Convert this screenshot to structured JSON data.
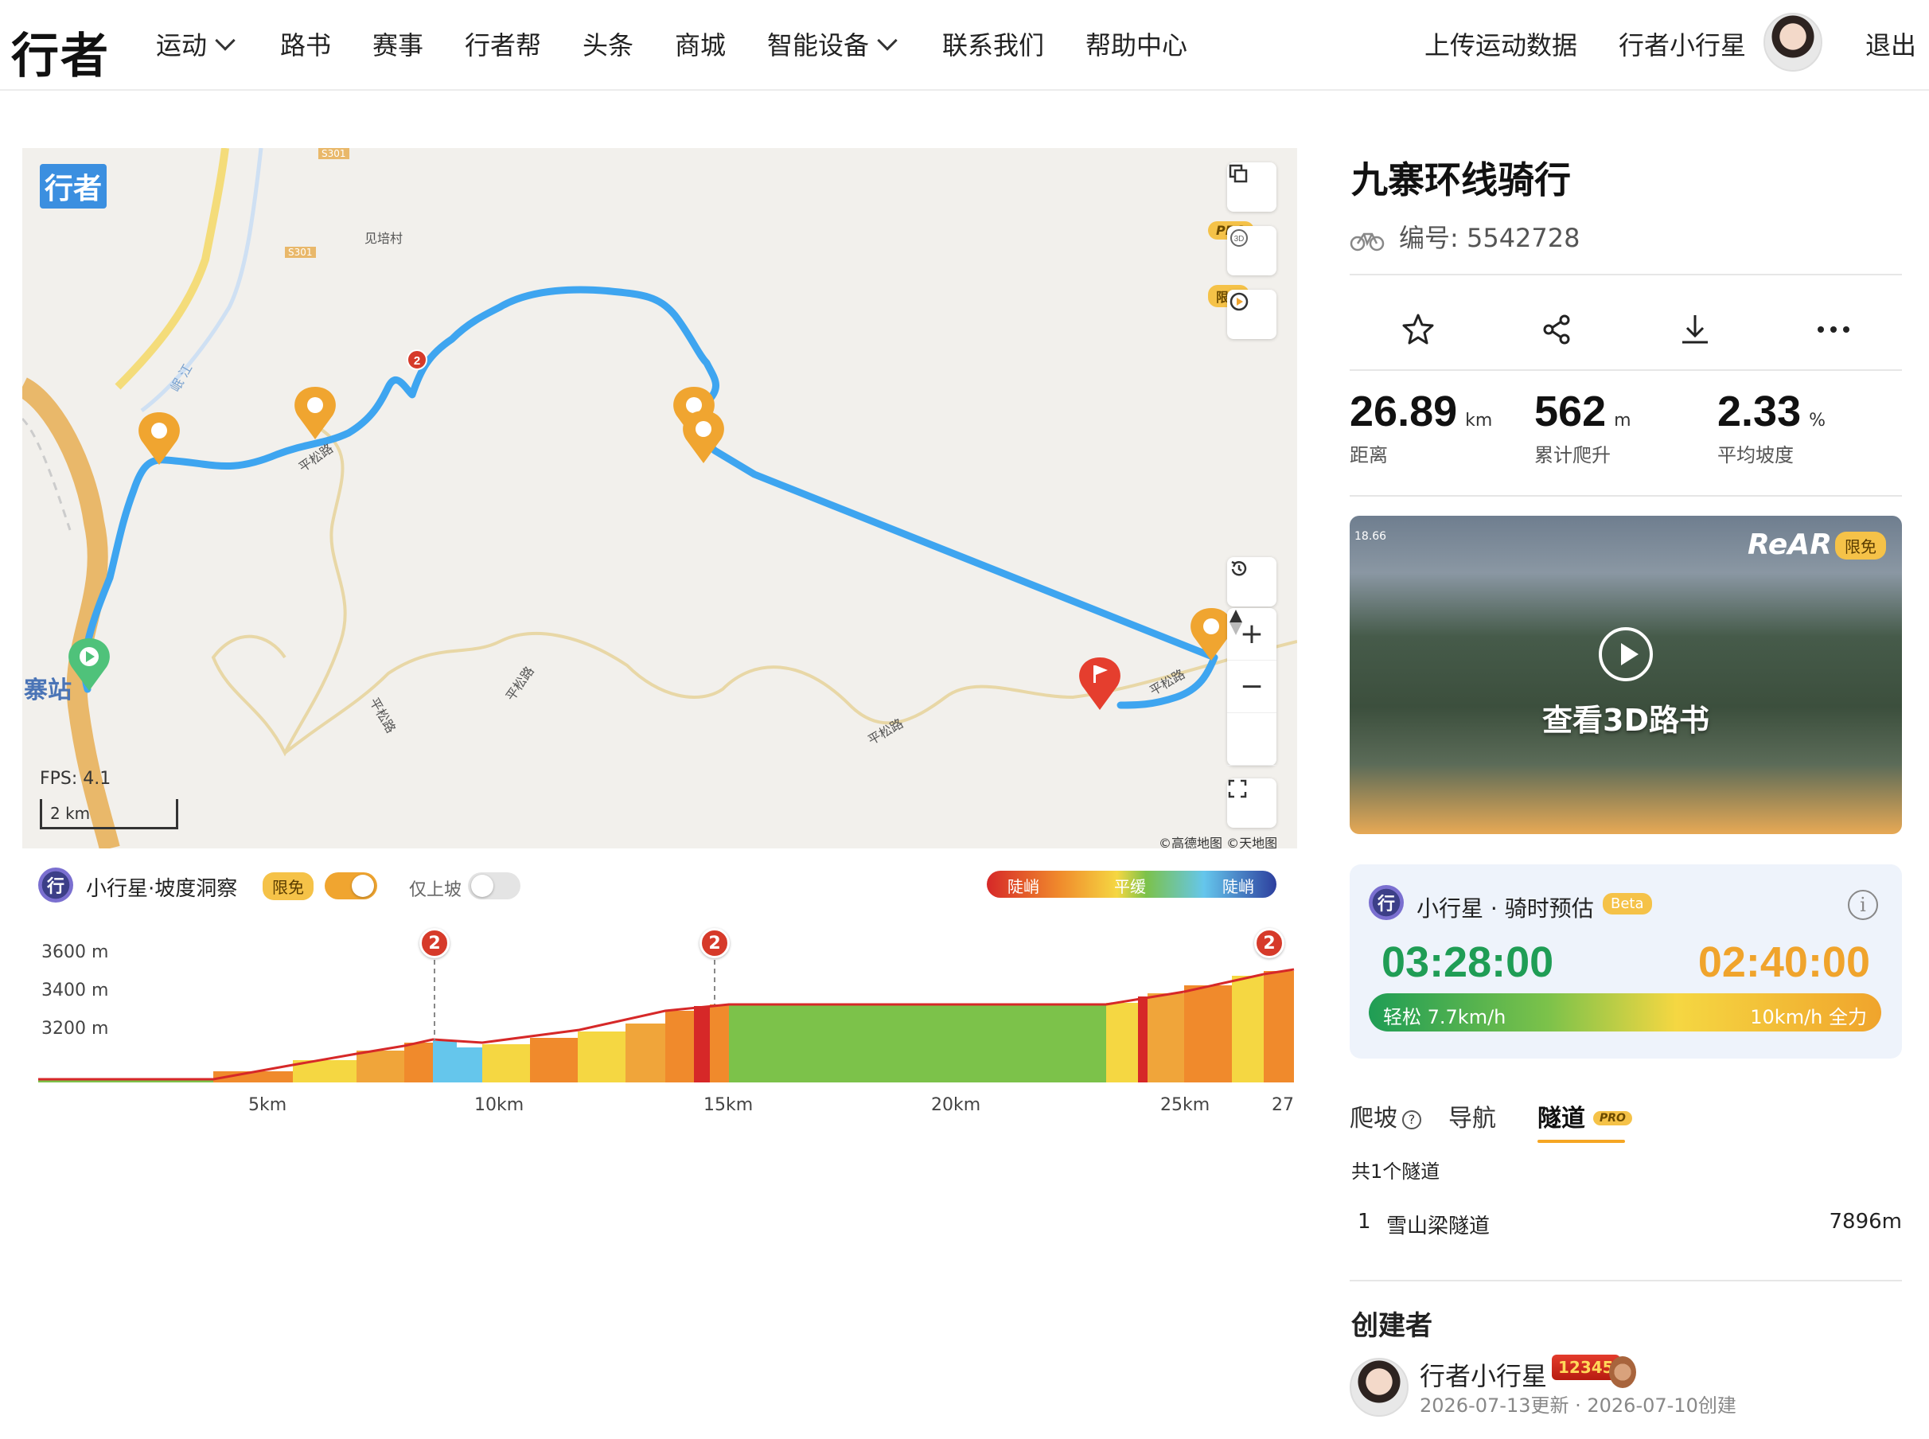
{
  "nav": {
    "logo": "行者",
    "items": [
      {
        "label": "运动",
        "dropdown": true
      },
      {
        "label": "路书"
      },
      {
        "label": "赛事"
      },
      {
        "label": "行者帮"
      },
      {
        "label": "头条"
      },
      {
        "label": "商城"
      },
      {
        "label": "智能设备",
        "dropdown": true
      },
      {
        "label": "联系我们"
      },
      {
        "label": "帮助中心"
      }
    ],
    "upload": "上传运动数据",
    "username": "行者小行星",
    "logout": "退出"
  },
  "map": {
    "logo": "行者",
    "fps": "FPS: 4.1",
    "scale": "2 km",
    "copyright": "©高德地图  ©天地图",
    "pro_tag": "PRO",
    "free_tag": "限免",
    "labels": {
      "village": "见培村",
      "road1": "平松路",
      "road2": "平松路",
      "road3": "平松路",
      "road4": "平松路",
      "road5": "平松路",
      "highway1": "S301",
      "highway2": "S301",
      "river": "岷 江",
      "town": "寨站"
    },
    "controls": {
      "zoom_in": "+",
      "zoom_out": "−"
    }
  },
  "slope": {
    "title": "小行星·坡度洞察",
    "free_badge": "限免",
    "uphill_only": "仅上坡",
    "legend": {
      "left": "陡峭",
      "middle": "平缓",
      "right": "陡峭"
    },
    "marker_label": "2"
  },
  "elevation": {
    "y_ticks": [
      "3600 m",
      "3400 m",
      "3200 m"
    ],
    "x_ticks": [
      "5km",
      "10km",
      "15km",
      "20km",
      "25km",
      "27"
    ]
  },
  "route": {
    "title": "九寨环线骑行",
    "id_label": "编号: ",
    "id_value": "5542728",
    "stats": [
      {
        "value": "26.89",
        "unit": "km",
        "label": "距离"
      },
      {
        "value": "562",
        "unit": "m",
        "label": "累计爬升"
      },
      {
        "value": "2.33",
        "unit": "%",
        "label": "平均坡度"
      }
    ],
    "preview": {
      "label": "查看3D路书",
      "brand": "ReAR",
      "free_badge": "限免",
      "speed_tag": "18.66"
    }
  },
  "estimate": {
    "title": "小行星 · 骑时预估",
    "beta": "Beta",
    "info": "i",
    "time_easy": "03:28:00",
    "time_full": "02:40:00",
    "easy_label": "轻松 7.7km/h",
    "full_label": "10km/h 全力",
    "colors": {
      "easy": "#1f9d55",
      "full": "#f0a42c"
    }
  },
  "tabs": {
    "climb": "爬坡",
    "help": "?",
    "navigation": "导航",
    "tunnel": "隧道",
    "pro": "PRO"
  },
  "tunnels": {
    "count_text": "共1个隧道",
    "rows": [
      {
        "index": "1",
        "name": "雪山梁隧道",
        "length": "7896m"
      }
    ]
  },
  "creator": {
    "title": "创建者",
    "name": "行者小行星",
    "level": "12345",
    "meta": "2026-07-13更新 · 2026-07-10创建"
  }
}
